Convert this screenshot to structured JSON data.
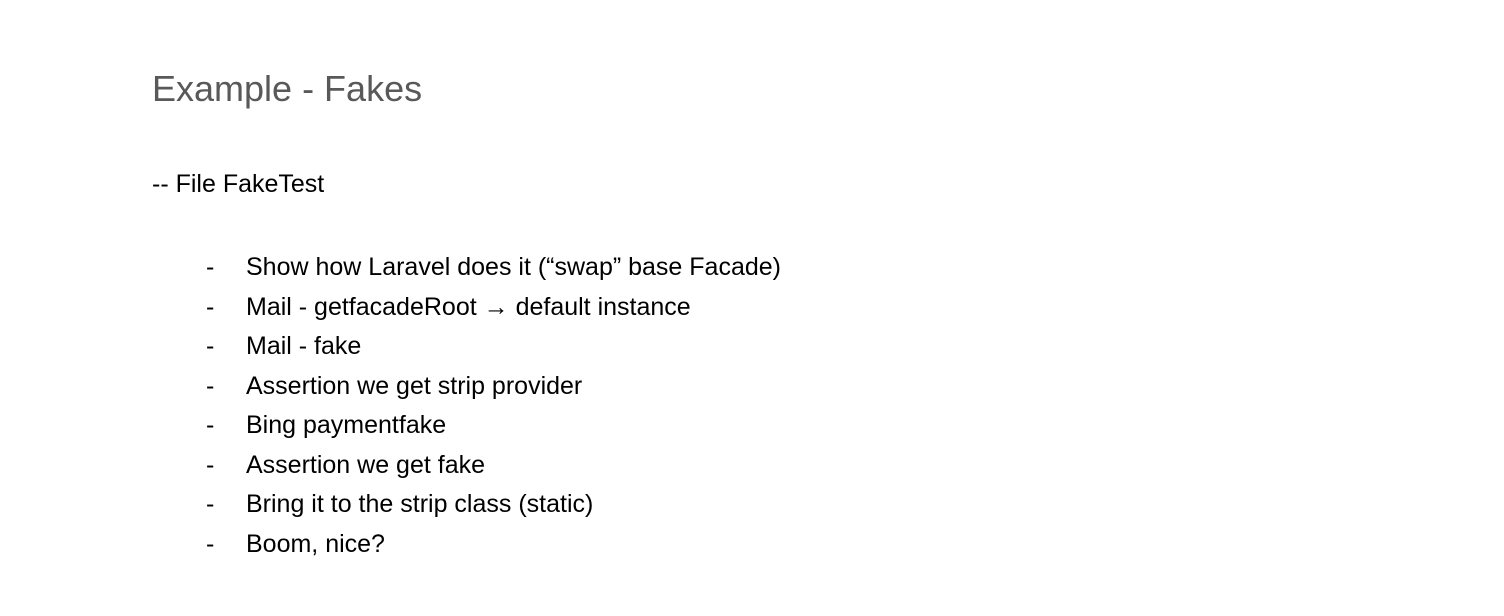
{
  "title": "Example - Fakes",
  "subtitle": "-- File FakeTest",
  "bullets": [
    "Show how Laravel does it (“swap” base Facade)",
    "Mail - getfacadeRoot → default instance",
    "Mail - fake",
    "Assertion we get strip provider",
    "Bing paymentfake",
    "Assertion we get fake",
    "Bring it to the strip class (static)",
    "Boom, nice?"
  ]
}
